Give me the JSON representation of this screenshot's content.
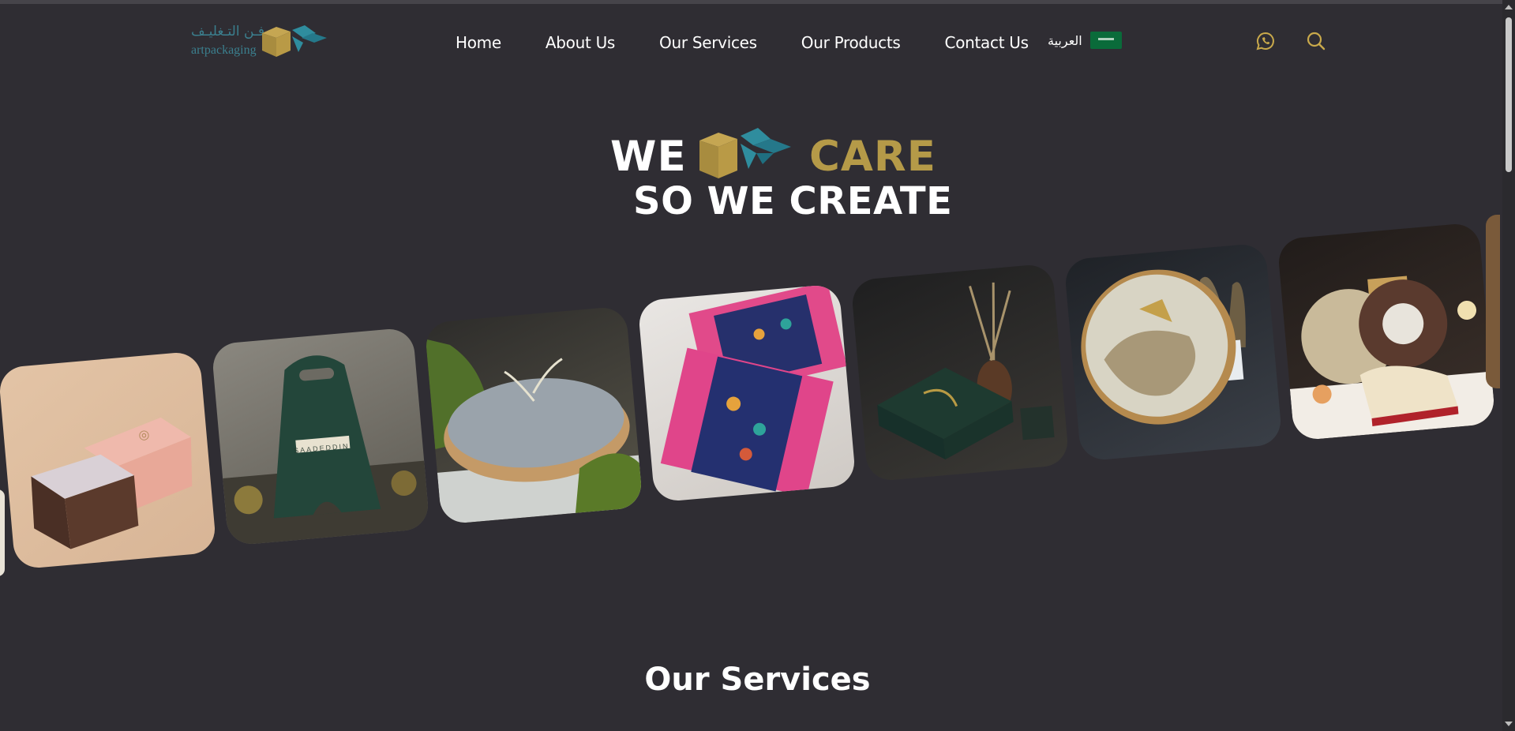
{
  "header": {
    "logo": {
      "arabic": "فـن التـغليـف",
      "english": "artpackaging"
    },
    "nav": [
      "Home",
      "About Us",
      "Our Services",
      "Our Products",
      "Contact Us"
    ],
    "language": {
      "label": "العربية",
      "flag": "saudi-flag"
    },
    "icons": [
      "whatsapp-icon",
      "search-icon"
    ]
  },
  "hero": {
    "word_left": "WE",
    "word_right": "CARE",
    "subtitle": "SO WE CREATE"
  },
  "gallery": {
    "cards": [
      {
        "name": "pink-brown-box-card",
        "label": ""
      },
      {
        "name": "green-handle-bag-card",
        "label": "SAADEDDIN"
      },
      {
        "name": "round-tin-olive-cloth-card",
        "label": ""
      },
      {
        "name": "floral-pattern-box-card",
        "label": ""
      },
      {
        "name": "dark-green-gift-box-card",
        "label": ""
      },
      {
        "name": "painted-round-tin-card",
        "label": ""
      },
      {
        "name": "embroidered-tray-card",
        "label": ""
      }
    ]
  },
  "sections": {
    "services_title": "Our Services"
  },
  "colors": {
    "background": "#2f2d33",
    "gold": "#b59a48",
    "teal": "#2f8d9e",
    "white": "#ffffff"
  }
}
